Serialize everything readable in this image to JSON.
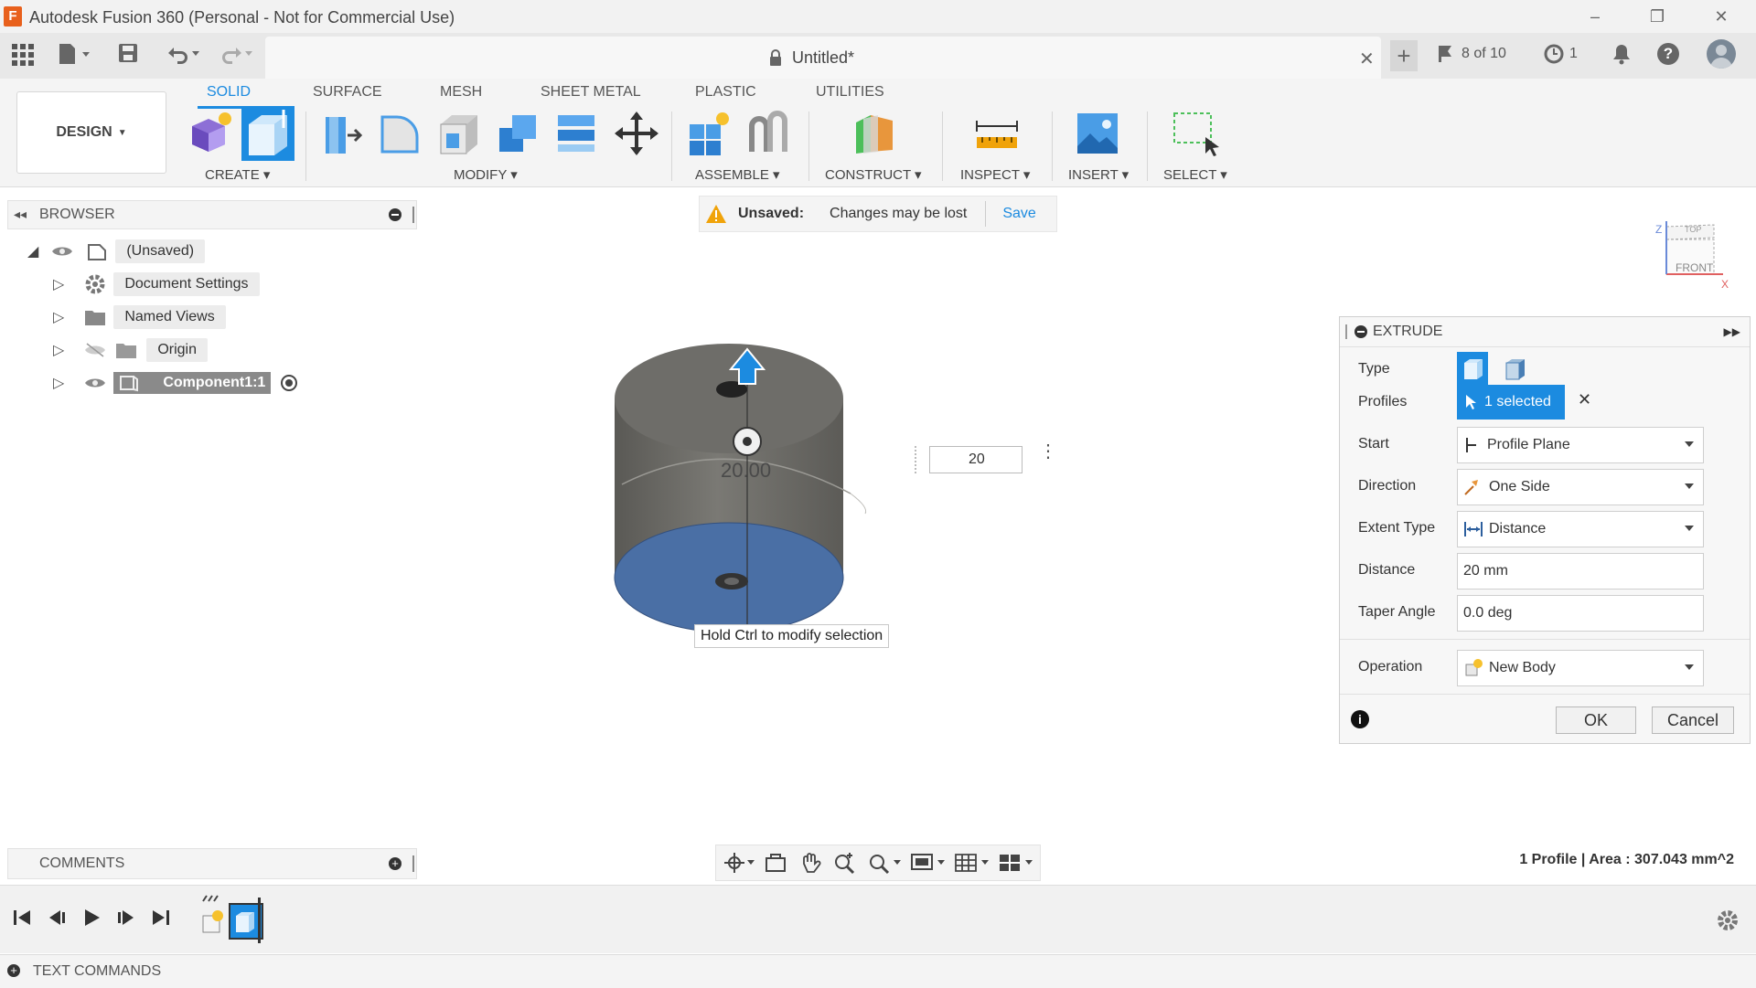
{
  "window": {
    "title": "Autodesk Fusion 360 (Personal - Not for Commercial Use)",
    "minimize": "–",
    "restore": "❐",
    "close": "✕"
  },
  "appbar": {
    "doc_title": "Untitled*",
    "version_counter": "8 of 10",
    "jobs_count": "1"
  },
  "toolbar": {
    "workspace": "DESIGN",
    "tabs": [
      "SOLID",
      "SURFACE",
      "MESH",
      "SHEET METAL",
      "PLASTIC",
      "UTILITIES"
    ],
    "groups": {
      "create": "CREATE",
      "modify": "MODIFY",
      "assemble": "ASSEMBLE",
      "construct": "CONSTRUCT",
      "inspect": "INSPECT",
      "insert": "INSERT",
      "select": "SELECT"
    }
  },
  "browser": {
    "title": "BROWSER",
    "root": "(Unsaved)",
    "items": [
      {
        "label": "Document Settings"
      },
      {
        "label": "Named Views"
      },
      {
        "label": "Origin"
      },
      {
        "label": "Component1:1"
      }
    ]
  },
  "banner": {
    "unsaved": "Unsaved:",
    "message": "Changes may be lost",
    "save": "Save"
  },
  "viewport": {
    "dimension_label": "20.00",
    "input_value": "20",
    "tooltip": "Hold Ctrl to modify selection",
    "viewcube_top": "TOP",
    "viewcube_front": "FRONT",
    "axis_z": "Z",
    "axis_x": "X"
  },
  "extrude": {
    "title": "EXTRUDE",
    "labels": {
      "type": "Type",
      "profiles": "Profiles",
      "start": "Start",
      "direction": "Direction",
      "extent_type": "Extent Type",
      "distance": "Distance",
      "taper_angle": "Taper Angle",
      "operation": "Operation"
    },
    "profiles_value": "1 selected",
    "start_value": "Profile Plane",
    "direction_value": "One Side",
    "extent_value": "Distance",
    "distance_value": "20 mm",
    "taper_value": "0.0 deg",
    "operation_value": "New Body",
    "ok": "OK",
    "cancel": "Cancel"
  },
  "comments": {
    "title": "COMMENTS"
  },
  "status": {
    "text": "1 Profile | Area : 307.043 mm^2"
  },
  "textcommands": {
    "title": "TEXT COMMANDS"
  },
  "colors": {
    "accent": "#1c8be0",
    "profile_fill": "#4a6fa5",
    "body": "#6e6d69",
    "warning": "#f0a30a"
  }
}
